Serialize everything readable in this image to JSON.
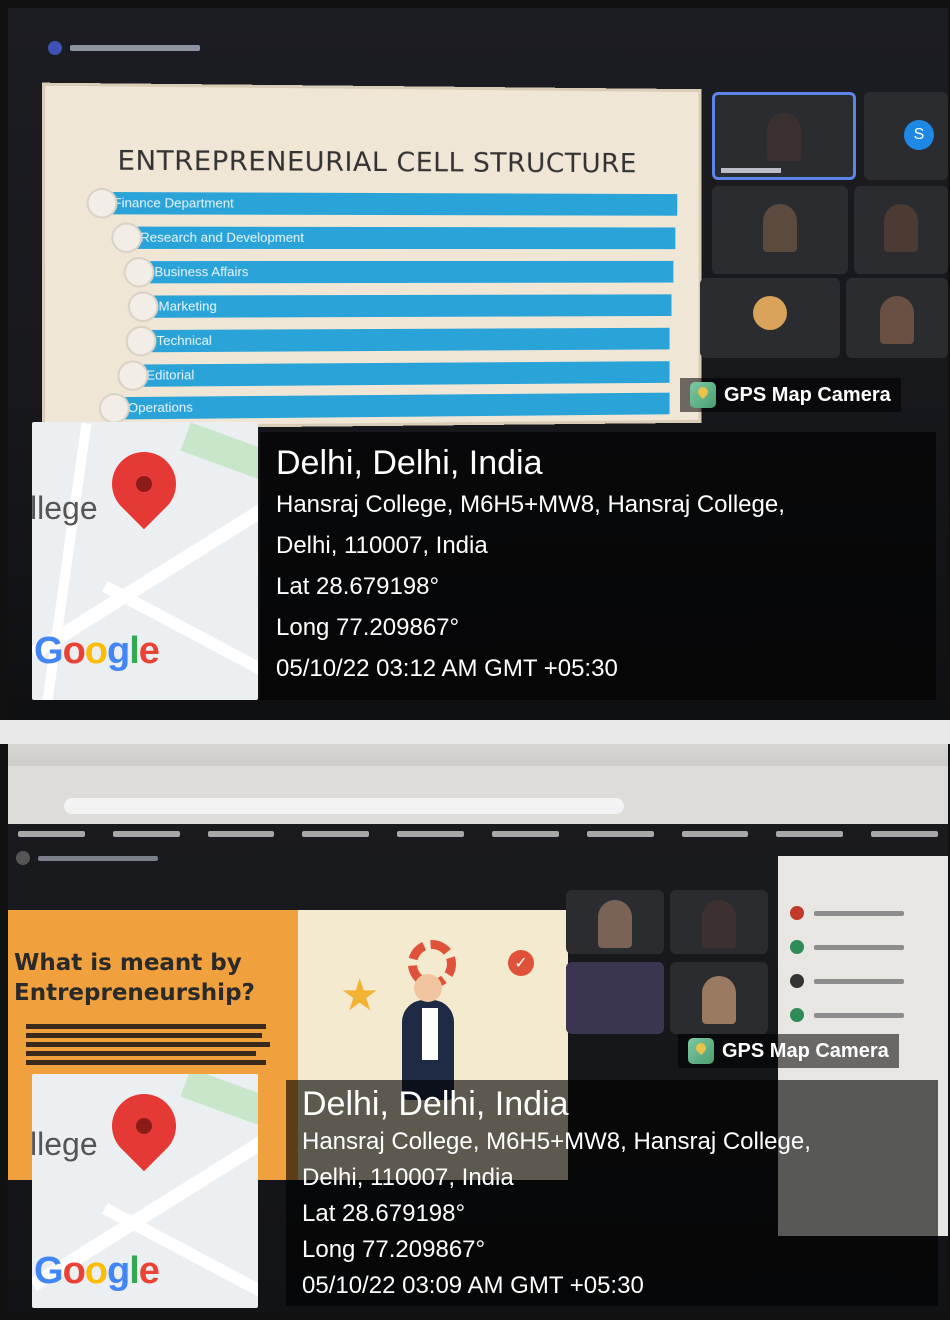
{
  "screenshots": [
    {
      "slide": {
        "title": "ENTREPRENEURIAL CELL STRUCTURE",
        "items": [
          "Finance Department",
          "Research and Development",
          "Business Affairs",
          "Marketing",
          "Technical",
          "Editorial",
          "Operations"
        ]
      },
      "participant_avatar_letter": "S",
      "gps_app_label": "GPS Map Camera",
      "map": {
        "label": "llege",
        "logo": "Google",
        "pin_icon": "location-pin-icon"
      },
      "location": {
        "city": "Delhi, Delhi, India",
        "address_line1": "Hansraj College, M6H5+MW8, Hansraj College,",
        "address_line2": "Delhi, 110007, India",
        "lat": "Lat 28.679198°",
        "long": "Long 77.209867°",
        "datetime": "05/10/22 03:12 AM GMT +05:30"
      }
    },
    {
      "slide": {
        "title_line1": "What is meant by",
        "title_line2": "Entrepreneurship?"
      },
      "gps_app_label": "GPS Map Camera",
      "map": {
        "label": "llege",
        "logo": "Google",
        "pin_icon": "location-pin-icon"
      },
      "location": {
        "city": "Delhi, Delhi, India",
        "address_line1": "Hansraj College, M6H5+MW8, Hansraj College,",
        "address_line2": "Delhi, 110007, India",
        "lat": "Lat 28.679198°",
        "long": "Long 77.209867°",
        "datetime": "05/10/22 03:09 AM GMT +05:30"
      }
    }
  ],
  "colors": {
    "slide_bar": "#2aa3d8",
    "slide2_accent": "#f0a03c",
    "pin": "#e53935"
  }
}
